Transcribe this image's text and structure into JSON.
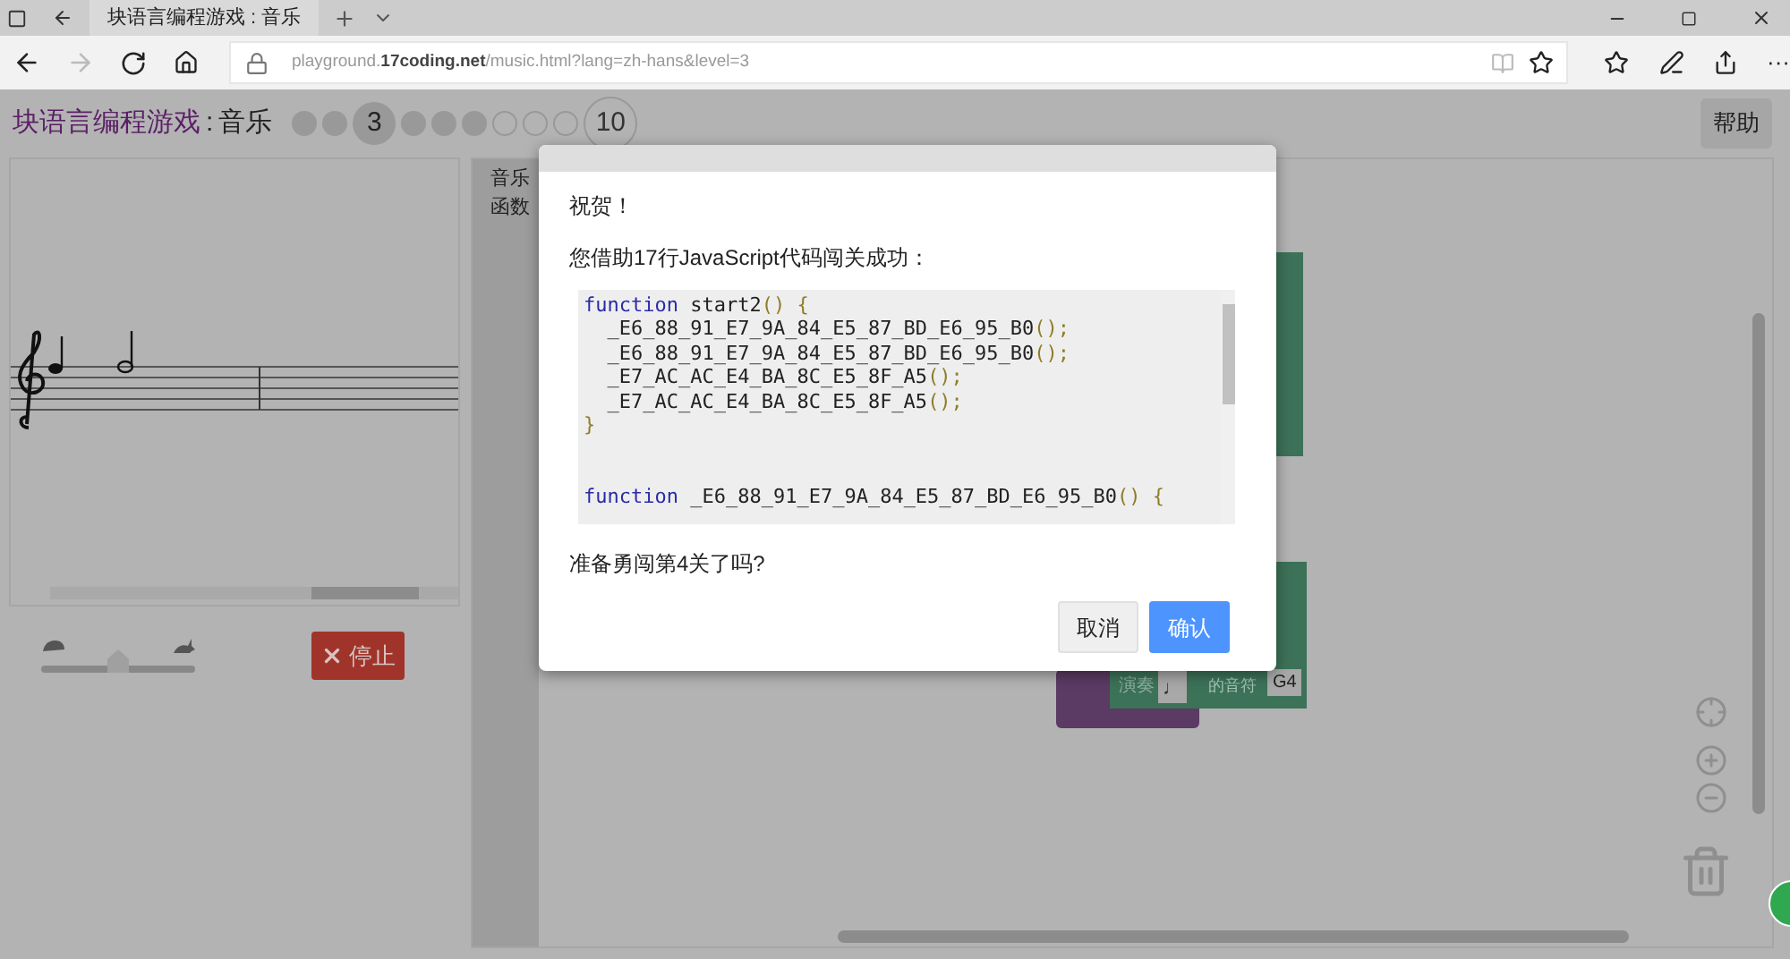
{
  "browser": {
    "tabs": [
      {
        "title": "块语言编程游戏 : 音乐",
        "selected": true
      }
    ],
    "forward_disabled": true,
    "url": "playground.**17coding.net**/music.html?lang=zh-hans&level=3",
    "more": "···"
  },
  "page": {
    "title": "块语言编程游戏",
    "separator": ":",
    "subtitle": "音乐",
    "help_button": "帮助"
  },
  "levels": [
    {
      "kind": "filled"
    },
    {
      "kind": "filled"
    },
    {
      "kind": "current",
      "label": "3"
    },
    {
      "kind": "filled"
    },
    {
      "kind": "filled"
    },
    {
      "kind": "filled"
    },
    {
      "kind": "hollow"
    },
    {
      "kind": "hollow"
    },
    {
      "kind": "hollow"
    },
    {
      "kind": "last",
      "label": "10"
    }
  ],
  "speed": {
    "level": 0.5
  },
  "stop_button": {
    "label": "停止"
  },
  "toolbox": {
    "categories": [
      "音乐",
      "函数"
    ]
  },
  "block_labels": {
    "action": "演奏",
    "note_value": "♩",
    "unit": "的音符",
    "note": "G4"
  },
  "dialog": {
    "title": "祝贺！",
    "message": "您借助17行JavaScript代码闯关成功：",
    "question": "准备勇闯第4关了吗?",
    "code": [
      {
        "kind": "code",
        "tokens": [
          {
            "kind": "keyword",
            "text": "function"
          },
          {
            "kind": "plain",
            "text": " start2"
          },
          {
            "kind": "punct",
            "text": "() {"
          }
        ]
      },
      {
        "kind": "code",
        "tokens": [
          {
            "kind": "plain",
            "text": "  _E6_88_91_E7_9A_84_E5_87_BD_E6_95_B0"
          },
          {
            "kind": "punct",
            "text": "();"
          }
        ]
      },
      {
        "kind": "code",
        "tokens": [
          {
            "kind": "plain",
            "text": "  _E6_88_91_E7_9A_84_E5_87_BD_E6_95_B0"
          },
          {
            "kind": "punct",
            "text": "();"
          }
        ]
      },
      {
        "kind": "code",
        "tokens": [
          {
            "kind": "plain",
            "text": "  _E7_AC_AC_E4_BA_8C_E5_8F_A5"
          },
          {
            "kind": "punct",
            "text": "();"
          }
        ]
      },
      {
        "kind": "code",
        "tokens": [
          {
            "kind": "plain",
            "text": "  _E7_AC_AC_E4_BA_8C_E5_8F_A5"
          },
          {
            "kind": "punct",
            "text": "();"
          }
        ]
      },
      {
        "kind": "code",
        "tokens": [
          {
            "kind": "punct",
            "text": "}"
          }
        ]
      },
      {
        "kind": "blank"
      },
      {
        "kind": "blank"
      },
      {
        "kind": "code",
        "tokens": [
          {
            "kind": "keyword",
            "text": "function"
          },
          {
            "kind": "plain",
            "text": " _E6_88_91_E7_9A_84_E5_87_BD_E6_95_B0"
          },
          {
            "kind": "punct",
            "text": "() {"
          }
        ]
      }
    ],
    "buttons": [
      {
        "label": "取消",
        "kind": "secondary"
      },
      {
        "label": "确认",
        "kind": "primary"
      }
    ]
  }
}
